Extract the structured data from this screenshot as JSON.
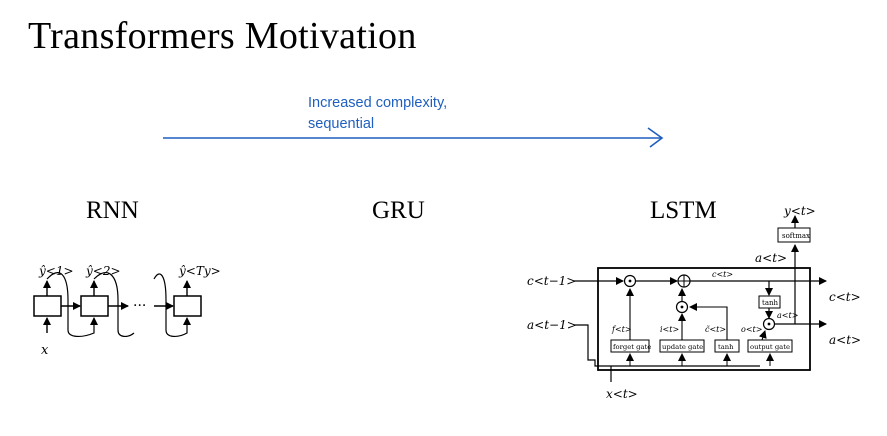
{
  "slide": {
    "title": "Transformers Motivation",
    "annotation": {
      "line1": "Increased complexity,",
      "line2": "sequential",
      "color": "#1f5fbf"
    },
    "models": {
      "rnn": "RNN",
      "gru": "GRU",
      "lstm": "LSTM"
    }
  },
  "rnn": {
    "outputs": [
      "ŷ<1>",
      "ŷ<2>",
      "ŷ<Ty>"
    ],
    "input": "x",
    "ellipsis": "···"
  },
  "lstm": {
    "c_prev": "c<t−1>",
    "a_prev": "a<t−1>",
    "x": "x<t>",
    "c_out": "c<t>",
    "c_inner": "c<t>",
    "a_out": "a<t>",
    "a_inner": "a<t>",
    "a_top": "a<t>",
    "y_top": "y<t>",
    "softmax": "softmax",
    "tanh_top": "tanh",
    "gates": {
      "forget": "forget gate",
      "update": "update gate",
      "tanh": "tanh",
      "output": "output gate"
    },
    "gate_symbols": {
      "f": "f<t>",
      "i": "i<t>",
      "c_tilde": "c̃<t>",
      "o": "o<t>"
    }
  }
}
